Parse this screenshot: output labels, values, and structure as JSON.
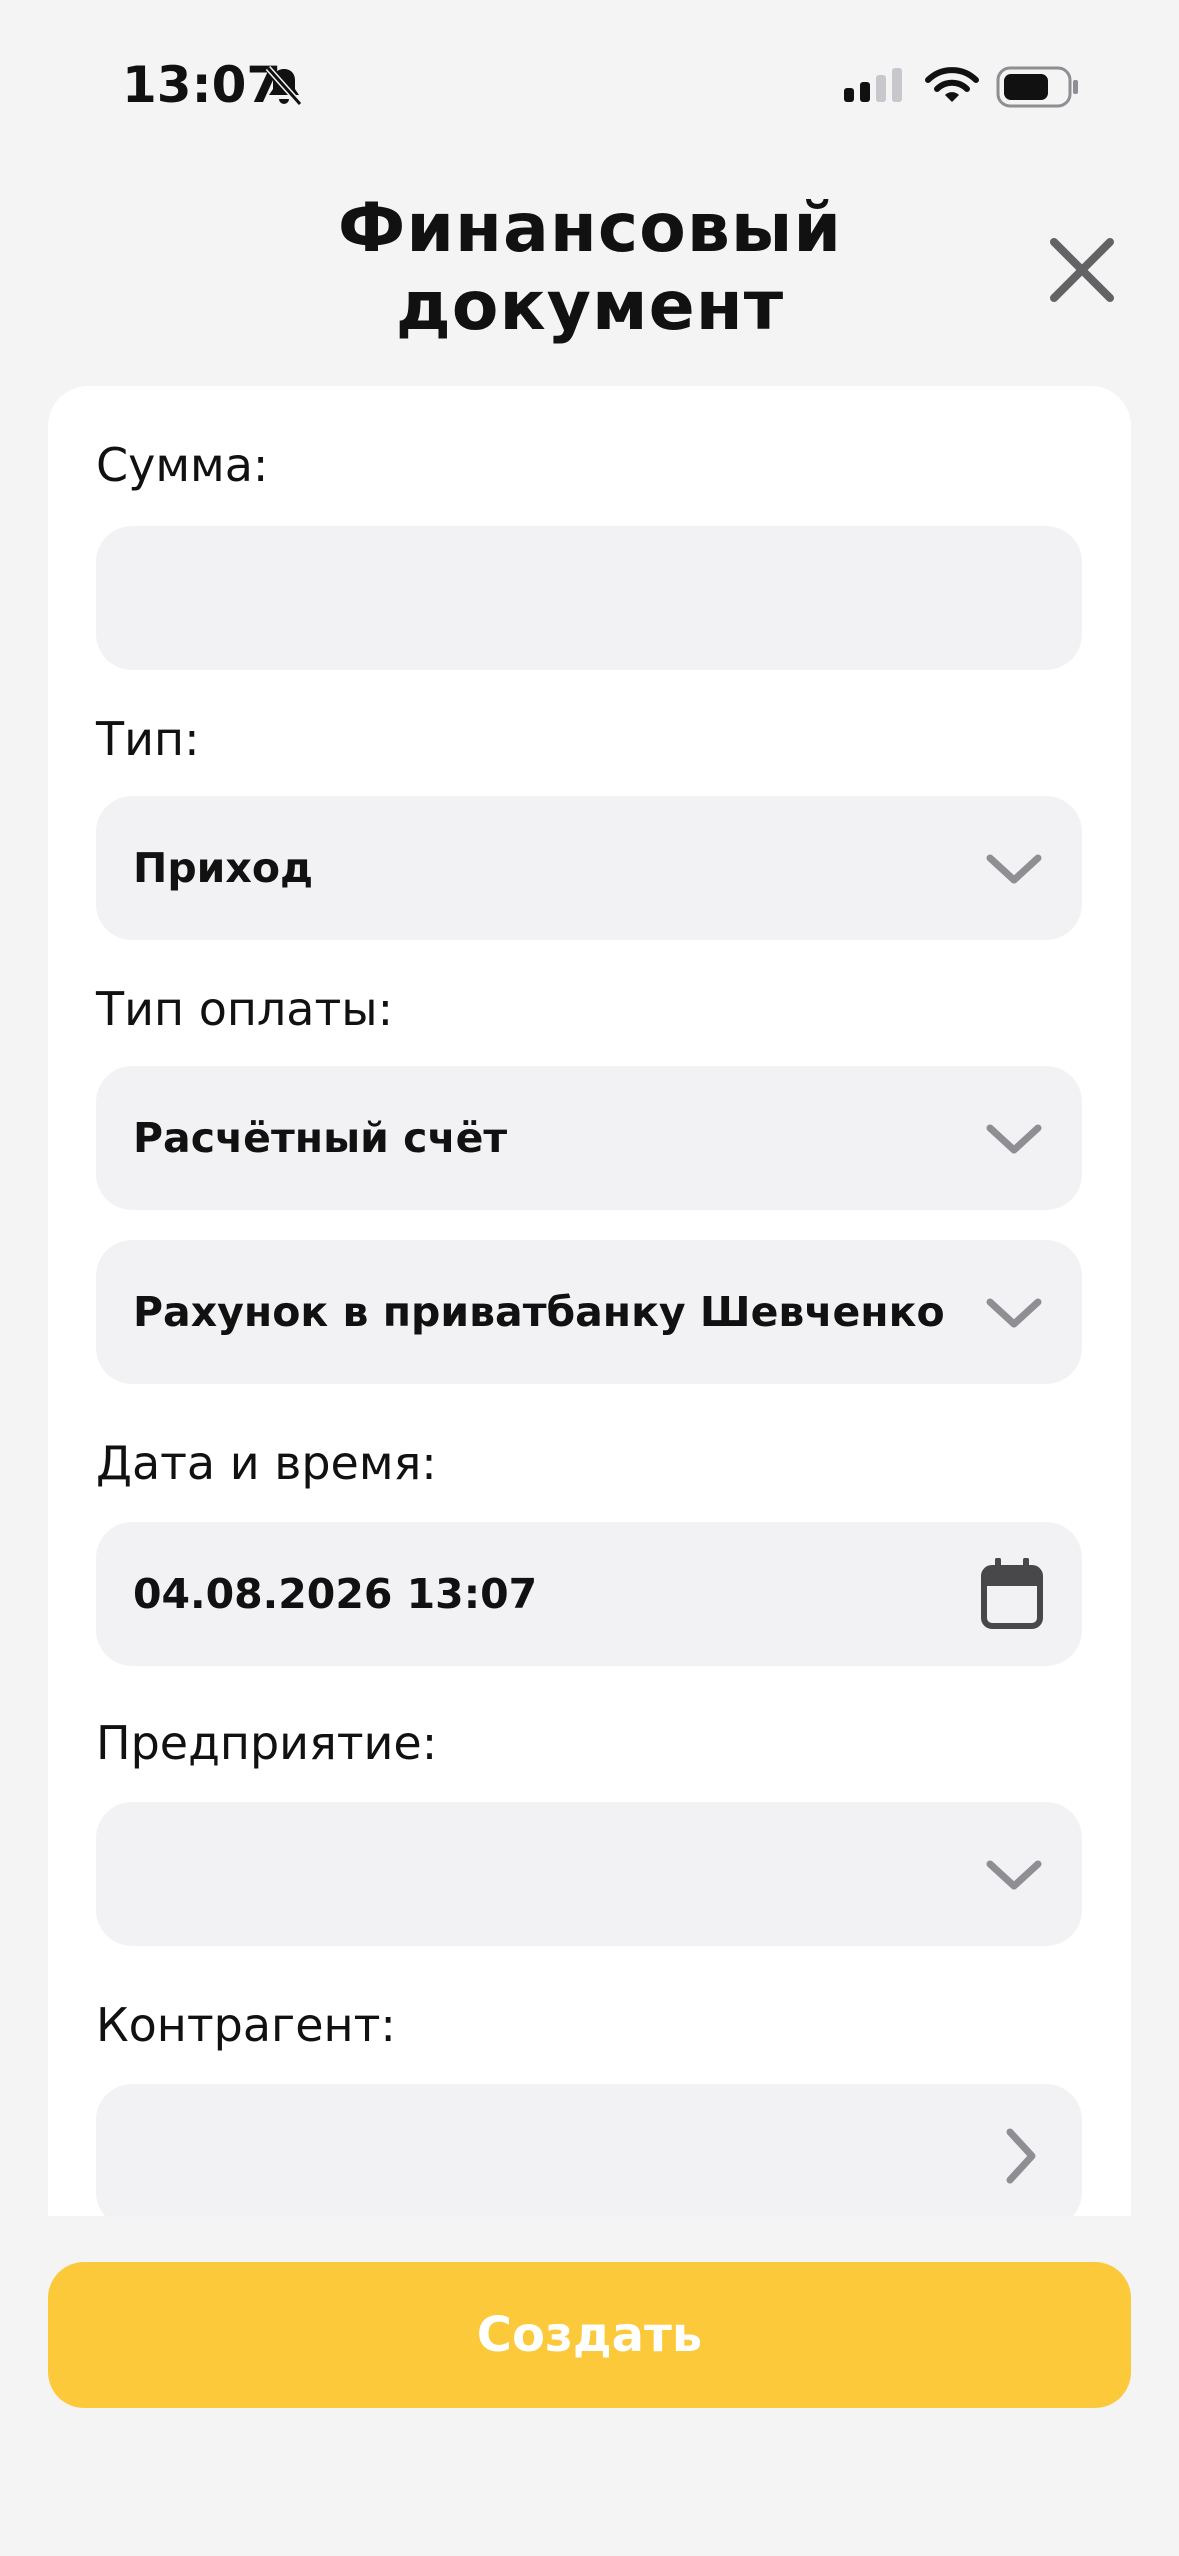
{
  "status_bar": {
    "time": "13:07"
  },
  "header": {
    "title_line1": "Финансовый",
    "title_line2": "документ"
  },
  "form": {
    "amount": {
      "label": "Сумма:",
      "value": ""
    },
    "type": {
      "label": "Тип:",
      "value": "Приход"
    },
    "payment_type": {
      "label": "Тип оплаты:",
      "value": "Расчётный счёт"
    },
    "account": {
      "value": "Рахунок в приватбанку Шевченко"
    },
    "datetime": {
      "label": "Дата и время:",
      "value": "04.08.2026 13:07"
    },
    "enterprise": {
      "label": "Предприятие:",
      "value": ""
    },
    "counterparty": {
      "label": "Контрагент:",
      "value": ""
    }
  },
  "actions": {
    "create_label": "Создать"
  },
  "colors": {
    "background": "#f4f4f5",
    "card": "#ffffff",
    "field": "#f2f2f4",
    "accent": "#fbc93a",
    "icon_gray": "#8e8e93",
    "icon_dark": "#48484a"
  }
}
